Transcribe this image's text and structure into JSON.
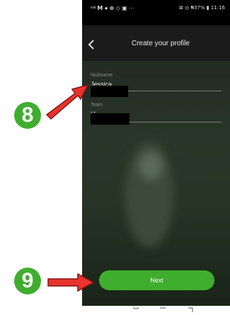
{
  "status_bar": {
    "left": "ᵉᵃˡ 𝗠 ● ⊕ ◇ ▣ ···",
    "right": "⊠ ◎ ₦37% ▮ 11:16"
  },
  "header": {
    "title": "Create your profile"
  },
  "form": {
    "nickname_label": "Nickname",
    "nickname_value": "Jessica",
    "team_label": "Team",
    "team_value": "H"
  },
  "buttons": {
    "next": "Next"
  },
  "annotations": {
    "step_a": "8",
    "step_b": "9"
  },
  "colors": {
    "accent_green": "#3fae2f",
    "arrow_red": "#e8332e"
  }
}
